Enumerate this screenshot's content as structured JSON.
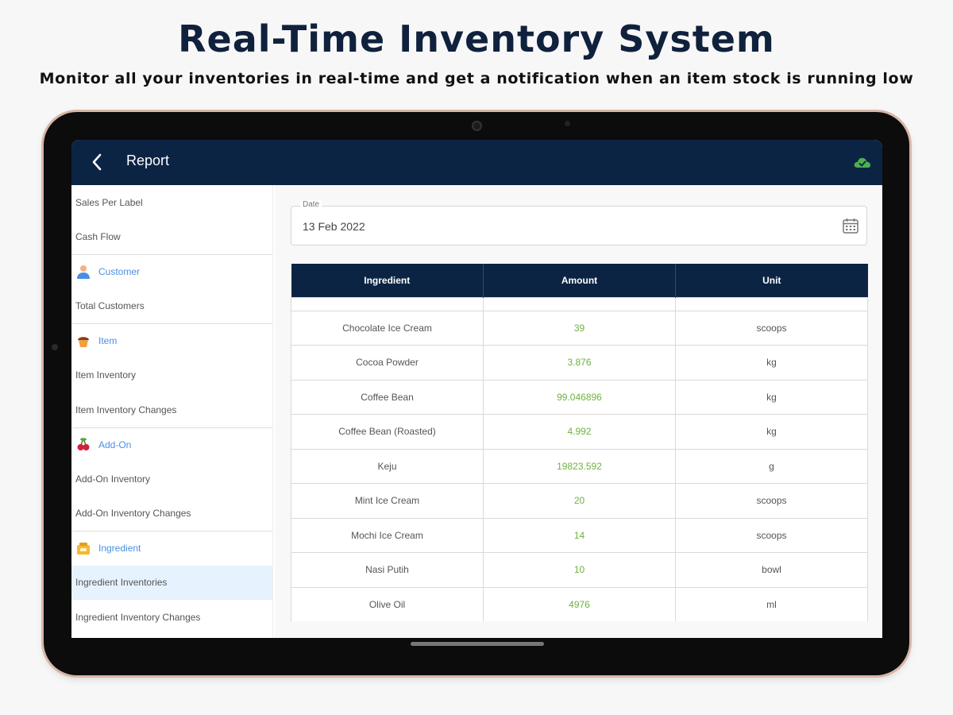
{
  "hero": {
    "title": "Real-Time Inventory System",
    "subtitle": "Monitor all your inventories in real-time and get a notification when an item stock is running low"
  },
  "appbar": {
    "title": "Report",
    "back_icon": "chevron-left-icon",
    "sync_icon": "cloud-check-icon",
    "sync_color": "#4caf50",
    "bg_color": "#0c2444"
  },
  "sidebar": {
    "top_items": [
      "Sales Per Label",
      "Cash Flow"
    ],
    "sections": [
      {
        "title": "Customer",
        "icon": "customer-icon",
        "items": [
          "Total Customers"
        ]
      },
      {
        "title": "Item",
        "icon": "item-icon",
        "items": [
          "Item Inventory",
          "Item Inventory Changes"
        ]
      },
      {
        "title": "Add-On",
        "icon": "addon-icon",
        "items": [
          "Add-On Inventory",
          "Add-On Inventory Changes"
        ]
      },
      {
        "title": "Ingredient",
        "icon": "ingredient-icon",
        "items": [
          "Ingredient Inventories",
          "Ingredient Inventory Changes"
        ]
      }
    ],
    "active_item": "Ingredient Inventories",
    "heading_color": "#4a90e2"
  },
  "date_filter": {
    "label": "Date",
    "value": "13 Feb 2022",
    "icon": "calendar-icon"
  },
  "table": {
    "headers": [
      "Ingredient",
      "Amount",
      "Unit"
    ],
    "rows": [
      [
        "Chocolate Ice Cream",
        "39",
        "scoops"
      ],
      [
        "Cocoa Powder",
        "3.876",
        "kg"
      ],
      [
        "Coffee Bean",
        "99.046896",
        "kg"
      ],
      [
        "Coffee Bean (Roasted)",
        "4.992",
        "kg"
      ],
      [
        "Keju",
        "19823.592",
        "g"
      ],
      [
        "Mint Ice Cream",
        "20",
        "scoops"
      ],
      [
        "Mochi Ice Cream",
        "14",
        "scoops"
      ],
      [
        "Nasi Putih",
        "10",
        "bowl"
      ],
      [
        "Olive Oil",
        "4976",
        "ml"
      ]
    ],
    "amount_color": "#6db33f"
  }
}
